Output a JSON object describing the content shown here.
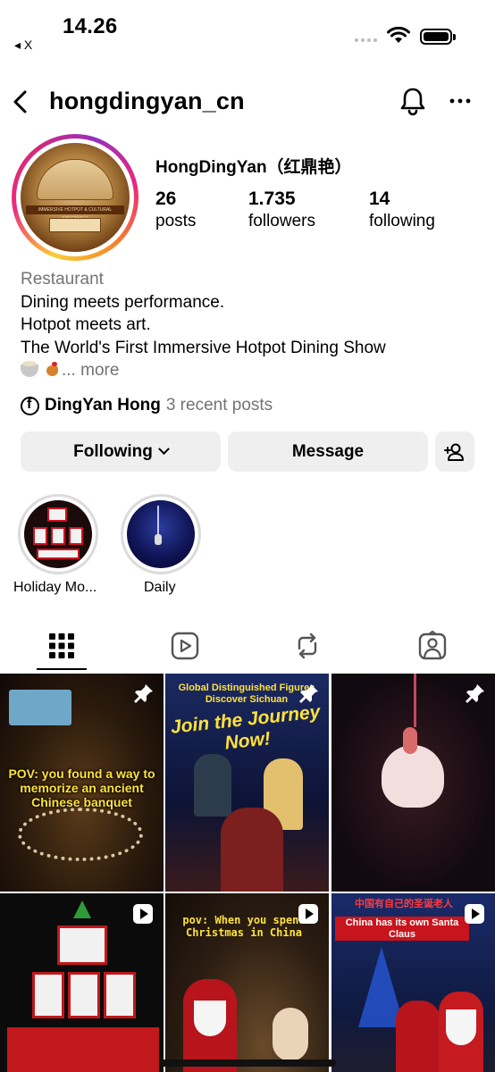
{
  "status_bar": {
    "time": "14.26",
    "back_app": "◂ X"
  },
  "header": {
    "username": "hongdingyan_cn"
  },
  "profile": {
    "display_name": "HongDingYan（红鼎艳）",
    "avatar_text": "IMMERSIVE HOTPOT & CULTURAL SPECTACLE",
    "stats": [
      {
        "value": "26",
        "label": "posts"
      },
      {
        "value": "1.735",
        "label": "followers"
      },
      {
        "value": "14",
        "label": "following"
      }
    ],
    "bio": {
      "category": "Restaurant",
      "lines": [
        "Dining meets performance.",
        "Hotpot meets art.",
        "The World's First Immersive Hotpot Dining Show"
      ],
      "more": "... more"
    },
    "facebook": {
      "name": "DingYan Hong",
      "count": "3 recent posts"
    }
  },
  "actions": {
    "following": "Following",
    "message": "Message"
  },
  "highlights": [
    {
      "label": "Holiday Mo..."
    },
    {
      "label": "Daily"
    }
  ],
  "tabs": [
    "grid-icon",
    "reels-icon",
    "reposts-icon",
    "tagged-icon"
  ],
  "posts": [
    {
      "caption": "POV: you found a way to memorize an ancient Chinese banquet",
      "badge": "pin"
    },
    {
      "caption_top": "Global Distinguished Figures Discover Sichuan",
      "caption_main": "Join the Journey Now!",
      "badge": "pin"
    },
    {
      "caption": "",
      "badge": "pin"
    },
    {
      "caption": "",
      "badge": "reel"
    },
    {
      "caption": "pov: When you spend Christmas in China",
      "badge": "reel"
    },
    {
      "caption_top": "中国有自己的圣诞老人",
      "caption_main": "China has its own Santa Claus",
      "badge": "reel"
    }
  ],
  "colors": {
    "muted_text": "#737373",
    "button_bg": "#efefef",
    "caption_yellow": "#ffe23a"
  }
}
